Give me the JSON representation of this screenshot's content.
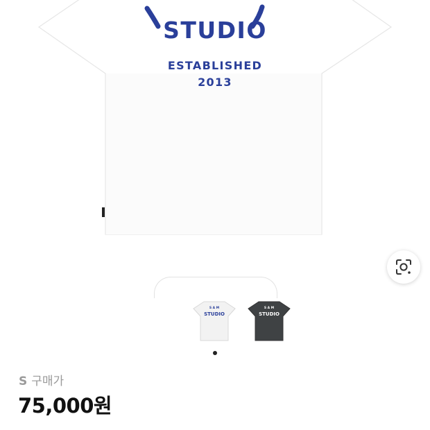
{
  "product_image": {
    "print_title": "STUDIO",
    "print_line1": "ESTABLISHED",
    "print_line2": "2013",
    "shirt_color": "#ffffff",
    "print_color": "#2a3f9a"
  },
  "lens_button": {
    "icon": "lens-search-icon"
  },
  "thumbnails": [
    {
      "variant": "white",
      "color": "#f2f2f2",
      "mini_top": "S A M",
      "mini_title": "STUDIO",
      "mini_print": "#2a3f9a"
    },
    {
      "variant": "charcoal",
      "color": "#3f4244",
      "mini_top": "S A M",
      "mini_title": "STUDIO",
      "mini_print": "#ffffff"
    }
  ],
  "pagination": {
    "active_index": 0,
    "count": 1
  },
  "price": {
    "size": "S",
    "label": "구매가",
    "value": "75,000원"
  }
}
